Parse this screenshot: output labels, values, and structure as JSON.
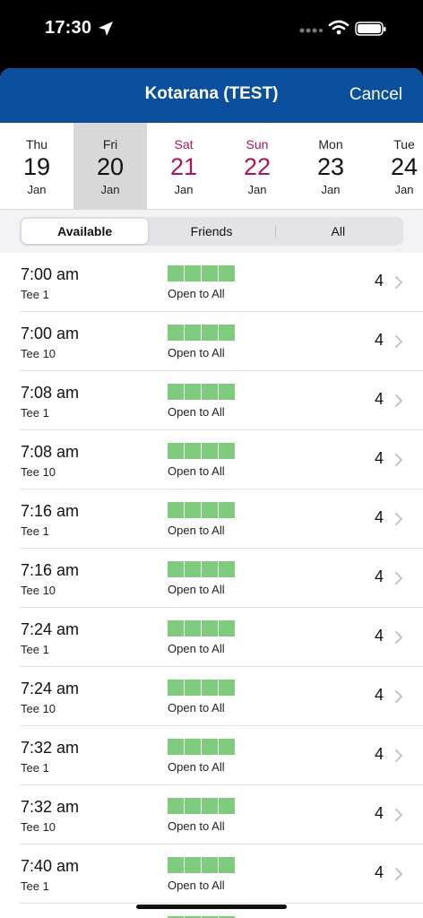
{
  "status_bar": {
    "time": "17:30"
  },
  "nav": {
    "title": "Kotarana (TEST)",
    "cancel_label": "Cancel"
  },
  "dates": [
    {
      "dow": "Thu",
      "num": "19",
      "mon": "Jan"
    },
    {
      "dow": "Fri",
      "num": "20",
      "mon": "Jan"
    },
    {
      "dow": "Sat",
      "num": "21",
      "mon": "Jan"
    },
    {
      "dow": "Sun",
      "num": "22",
      "mon": "Jan"
    },
    {
      "dow": "Mon",
      "num": "23",
      "mon": "Jan"
    },
    {
      "dow": "Tue",
      "num": "24",
      "mon": "Jan"
    }
  ],
  "filter": {
    "available": "Available",
    "friends": "Friends",
    "all": "All"
  },
  "rows": [
    {
      "time": "7:00 am",
      "tee": "Tee 1",
      "status": "Open to All",
      "count": "4"
    },
    {
      "time": "7:00 am",
      "tee": "Tee 10",
      "status": "Open to All",
      "count": "4"
    },
    {
      "time": "7:08 am",
      "tee": "Tee 1",
      "status": "Open to All",
      "count": "4"
    },
    {
      "time": "7:08 am",
      "tee": "Tee 10",
      "status": "Open to All",
      "count": "4"
    },
    {
      "time": "7:16 am",
      "tee": "Tee 1",
      "status": "Open to All",
      "count": "4"
    },
    {
      "time": "7:16 am",
      "tee": "Tee 10",
      "status": "Open to All",
      "count": "4"
    },
    {
      "time": "7:24 am",
      "tee": "Tee 1",
      "status": "Open to All",
      "count": "4"
    },
    {
      "time": "7:24 am",
      "tee": "Tee 10",
      "status": "Open to All",
      "count": "4"
    },
    {
      "time": "7:32 am",
      "tee": "Tee 1",
      "status": "Open to All",
      "count": "4"
    },
    {
      "time": "7:32 am",
      "tee": "Tee 10",
      "status": "Open to All",
      "count": "4"
    },
    {
      "time": "7:40 am",
      "tee": "Tee 1",
      "status": "Open to All",
      "count": "4"
    },
    {
      "time": "",
      "tee": "",
      "status": "",
      "count": ""
    }
  ],
  "colors": {
    "nav_bg": "#0a4f9e",
    "weekend": "#b0125e",
    "slot_green": "#7fcb7e"
  }
}
